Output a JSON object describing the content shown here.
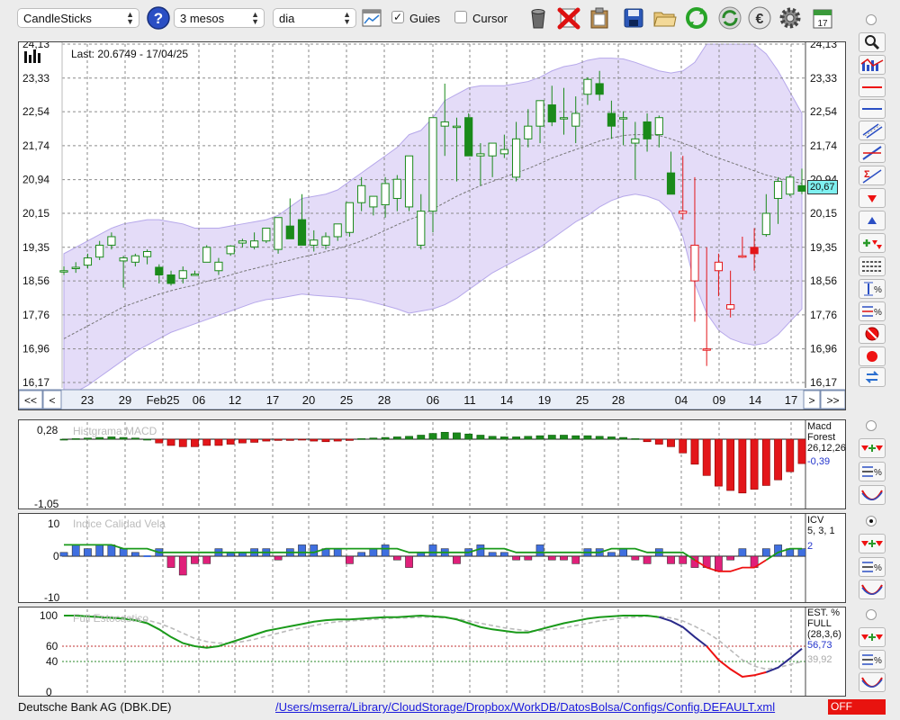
{
  "toolbar": {
    "chart_type": "CandleSticks",
    "period": "3 mesos",
    "interval": "dia",
    "guides_label": "Guies",
    "guides_checked": true,
    "cursor_label": "Cursor",
    "cursor_checked": false
  },
  "main": {
    "last_label": "Last: 20.6749 - 17/04/25",
    "current_price_label": "20,67",
    "y_ticks": [
      "24,13",
      "23,33",
      "22,54",
      "21,74",
      "20,94",
      "20,15",
      "19,35",
      "18,56",
      "17,76",
      "16,96",
      "16,17"
    ],
    "x_labels": [
      "23",
      "29",
      "Feb25",
      "06",
      "12",
      "17",
      "20",
      "25",
      "28",
      "06",
      "11",
      "14",
      "19",
      "25",
      "28",
      "04",
      "09",
      "14",
      "17"
    ],
    "nav_first": "<<",
    "nav_prev": "<",
    "nav_next": ">",
    "nav_last": ">>"
  },
  "macd": {
    "title": "Histgrama MACD",
    "name": "Macd",
    "sub": "Forest",
    "params": "26,12,26",
    "value": "-0,39",
    "y_top": "0,28",
    "y_bottom": "-1,05"
  },
  "icv": {
    "title": "Indice Calidad Vela",
    "name": "ICV",
    "params": "5, 3, 1",
    "value": "2",
    "y_top": "10",
    "y_mid": "0",
    "y_bottom": "-10"
  },
  "stoch": {
    "title": "Full Estocastico",
    "name": "EST. %",
    "sub": "FULL",
    "params": "(28,3,6)",
    "value1": "56,73",
    "value2": "39,92",
    "y_ticks": [
      "100",
      "60",
      "40",
      "0"
    ]
  },
  "status": {
    "symbol": "Deutsche Bank AG (DBK.DE)",
    "config_path": "/Users/mserra/Library/CloudStorage/Dropbox/WorkDB/DatosBolsa/Configs/Config.DEFAULT.xml",
    "mode": "OFF"
  },
  "colors": {
    "up": "#1a8a1a",
    "down": "#e3161a",
    "band": "#e4dcf8",
    "blue_bar": "#3f6fe0",
    "pink_bar": "#e0207a",
    "accent_label": "#7ff0f0"
  },
  "icons": [
    "help-icon",
    "chart-setup-icon",
    "trash-icon",
    "delete-icon",
    "clipboard-icon",
    "save-icon",
    "folder-icon",
    "refresh-icon",
    "sync-icon",
    "euro-icon",
    "gear-icon",
    "calendar-icon"
  ],
  "chart_data": {
    "type": "candlestick",
    "ylim": [
      16.17,
      24.13
    ],
    "dates": [
      "01-21",
      "01-22",
      "01-23",
      "01-24",
      "01-27",
      "01-28",
      "01-29",
      "01-30",
      "01-31",
      "02-03",
      "02-04",
      "02-05",
      "02-06",
      "02-07",
      "02-10",
      "02-11",
      "02-12",
      "02-13",
      "02-14",
      "02-17",
      "02-18",
      "02-19",
      "02-20",
      "02-21",
      "02-24",
      "02-25",
      "02-26",
      "02-27",
      "02-28",
      "03-03",
      "03-04",
      "03-05",
      "03-06",
      "03-07",
      "03-10",
      "03-11",
      "03-12",
      "03-13",
      "03-14",
      "03-17",
      "03-18",
      "03-19",
      "03-20",
      "03-21",
      "03-24",
      "03-25",
      "03-26",
      "03-27",
      "03-28",
      "03-31",
      "04-01",
      "04-02",
      "04-03",
      "04-04",
      "04-07",
      "04-08",
      "04-09",
      "04-10",
      "04-11",
      "04-14",
      "04-15",
      "04-16",
      "04-17"
    ],
    "open": [
      18.78,
      18.85,
      18.93,
      19.12,
      19.4,
      19.03,
      19.0,
      19.13,
      18.88,
      18.7,
      18.62,
      18.7,
      19.0,
      18.8,
      19.2,
      19.45,
      19.36,
      19.5,
      19.3,
      19.85,
      20.0,
      19.4,
      19.4,
      19.6,
      19.7,
      20.4,
      20.3,
      20.35,
      20.5,
      20.3,
      19.4,
      20.2,
      22.2,
      22.2,
      22.4,
      21.5,
      21.5,
      21.55,
      21.0,
      21.9,
      22.2,
      22.7,
      22.4,
      22.2,
      22.95,
      23.2,
      22.5,
      22.4,
      21.8,
      22.3,
      22.0,
      21.1,
      20.15,
      18.56,
      16.96,
      18.8,
      17.9,
      19.15,
      19.35,
      19.65,
      20.5,
      20.6,
      20.8
    ],
    "high": [
      18.9,
      19.0,
      19.2,
      19.5,
      19.7,
      19.15,
      19.2,
      19.3,
      18.95,
      18.8,
      18.9,
      18.8,
      19.4,
      19.1,
      19.4,
      19.55,
      19.7,
      19.8,
      20.05,
      20.5,
      20.6,
      19.75,
      19.7,
      19.9,
      20.4,
      21.0,
      20.55,
      21.0,
      21.05,
      21.5,
      20.6,
      22.2,
      23.2,
      22.4,
      22.5,
      21.8,
      21.6,
      22.0,
      22.3,
      22.6,
      22.7,
      23.15,
      23.1,
      22.9,
      23.35,
      23.5,
      22.8,
      22.55,
      22.3,
      22.5,
      22.45,
      21.6,
      21.5,
      21.0,
      19.35,
      19.2,
      18.8,
      19.6,
      19.8,
      20.6,
      21.0,
      21.05,
      21.2
    ],
    "low": [
      18.7,
      18.75,
      18.85,
      19.05,
      19.3,
      18.4,
      18.9,
      18.95,
      18.5,
      18.45,
      18.5,
      18.7,
      19.0,
      18.7,
      19.15,
      19.35,
      19.3,
      19.45,
      19.2,
      19.6,
      19.9,
      19.25,
      19.3,
      19.5,
      19.6,
      20.2,
      20.1,
      20.05,
      20.2,
      20.2,
      19.3,
      19.7,
      21.5,
      20.9,
      21.9,
      20.8,
      21.0,
      21.45,
      20.9,
      21.7,
      21.8,
      22.2,
      22.0,
      21.8,
      22.7,
      22.8,
      21.9,
      21.75,
      20.95,
      21.6,
      21.7,
      20.75,
      20.0,
      17.6,
      16.56,
      18.2,
      17.7,
      19.1,
      18.8,
      19.6,
      19.9,
      20.55,
      20.6
    ],
    "close": [
      18.8,
      18.88,
      19.1,
      19.4,
      19.6,
      19.1,
      19.15,
      19.25,
      18.7,
      18.5,
      18.8,
      18.72,
      19.35,
      19.0,
      19.38,
      19.5,
      19.5,
      19.8,
      20.05,
      19.55,
      19.4,
      19.52,
      19.6,
      19.9,
      20.4,
      20.8,
      20.55,
      20.85,
      20.95,
      21.5,
      20.2,
      22.4,
      22.3,
      22.2,
      21.5,
      21.55,
      21.8,
      21.65,
      21.9,
      22.2,
      22.8,
      22.3,
      22.4,
      22.5,
      23.3,
      22.95,
      22.2,
      22.4,
      21.9,
      21.9,
      22.4,
      20.6,
      20.2,
      19.4,
      16.96,
      19.0,
      18.0,
      19.15,
      19.2,
      20.15,
      20.9,
      21.0,
      20.67
    ],
    "bollinger_upper": [
      19.2,
      19.35,
      19.5,
      19.65,
      19.8,
      19.9,
      19.95,
      20.0,
      20.0,
      19.95,
      19.9,
      19.8,
      19.8,
      19.8,
      19.85,
      19.9,
      19.95,
      20.0,
      20.1,
      20.3,
      20.5,
      20.55,
      20.6,
      20.7,
      20.9,
      21.1,
      21.3,
      21.5,
      21.7,
      22.0,
      22.1,
      22.4,
      22.8,
      22.95,
      23.1,
      23.15,
      23.15,
      23.15,
      23.2,
      23.25,
      23.35,
      23.5,
      23.6,
      23.65,
      23.75,
      23.8,
      23.8,
      23.78,
      23.7,
      23.6,
      23.5,
      23.45,
      23.5,
      23.7,
      24.13,
      24.13,
      24.13,
      24.13,
      24.13,
      23.9,
      23.5,
      23.0,
      22.5
    ],
    "bollinger_middle": [
      17.2,
      17.35,
      17.5,
      17.65,
      17.8,
      17.95,
      18.05,
      18.15,
      18.25,
      18.33,
      18.4,
      18.46,
      18.55,
      18.62,
      18.7,
      18.78,
      18.85,
      18.92,
      18.98,
      19.05,
      19.12,
      19.18,
      19.25,
      19.32,
      19.4,
      19.5,
      19.62,
      19.75,
      19.88,
      20.0,
      20.1,
      20.25,
      20.4,
      20.55,
      20.68,
      20.8,
      20.9,
      21.0,
      21.1,
      21.2,
      21.32,
      21.45,
      21.55,
      21.65,
      21.75,
      21.85,
      21.92,
      21.98,
      22.0,
      22.0,
      21.98,
      21.9,
      21.8,
      21.7,
      21.55,
      21.45,
      21.35,
      21.25,
      21.15,
      21.05,
      20.98,
      20.92,
      20.85
    ],
    "bollinger_lower": [
      15.8,
      15.95,
      16.1,
      16.3,
      16.5,
      16.7,
      16.9,
      17.05,
      17.2,
      17.35,
      17.45,
      17.55,
      17.65,
      17.75,
      17.85,
      17.95,
      18.05,
      18.12,
      18.15,
      18.2,
      18.25,
      18.22,
      18.2,
      18.18,
      18.15,
      18.12,
      18.05,
      17.98,
      17.9,
      17.8,
      17.85,
      17.9,
      18.0,
      18.15,
      18.35,
      18.55,
      18.75,
      18.9,
      19.05,
      19.2,
      19.35,
      19.55,
      19.75,
      19.95,
      20.1,
      20.3,
      20.45,
      20.55,
      20.6,
      20.55,
      20.45,
      20.2,
      19.6,
      18.5,
      17.8,
      17.4,
      17.2,
      17.1,
      17.05,
      17.1,
      17.3,
      17.6,
      17.9
    ],
    "macd_hist": [
      0.0,
      0.02,
      0.04,
      0.06,
      0.08,
      0.06,
      0.04,
      0.0,
      -0.06,
      -0.1,
      -0.12,
      -0.12,
      -0.1,
      -0.1,
      -0.08,
      -0.06,
      -0.05,
      -0.03,
      -0.02,
      -0.02,
      -0.01,
      -0.03,
      -0.04,
      -0.03,
      -0.02,
      0.02,
      0.04,
      0.06,
      0.08,
      0.1,
      0.14,
      0.2,
      0.24,
      0.22,
      0.18,
      0.14,
      0.1,
      0.08,
      0.08,
      0.1,
      0.12,
      0.14,
      0.14,
      0.12,
      0.12,
      0.1,
      0.08,
      0.06,
      0.02,
      -0.04,
      -0.08,
      -0.12,
      -0.22,
      -0.4,
      -0.58,
      -0.75,
      -0.82,
      -0.86,
      -0.8,
      -0.74,
      -0.65,
      -0.52,
      -0.39
    ],
    "icv_bars": [
      1,
      3,
      2,
      3,
      3,
      2,
      1,
      0,
      2,
      -3,
      -5,
      -2,
      -2,
      2,
      1,
      1,
      2,
      2,
      -1,
      2,
      3,
      3,
      2,
      2,
      -2,
      1,
      2,
      3,
      -1,
      -3,
      1,
      3,
      2,
      -2,
      2,
      3,
      1,
      1,
      -1,
      -1,
      3,
      -1,
      -1,
      -2,
      2,
      2,
      1,
      2,
      -1,
      -2,
      2,
      -2,
      -2,
      -3,
      -3,
      -4,
      -1,
      2,
      -3,
      2,
      3,
      2,
      2
    ],
    "icv_line": [
      3,
      3,
      3,
      3,
      3,
      2,
      2,
      2,
      1,
      1,
      1,
      1,
      1,
      1,
      1,
      1,
      1,
      1,
      1,
      1,
      1,
      1,
      2,
      2,
      2,
      2,
      2,
      2,
      2,
      1,
      1,
      1,
      1,
      1,
      1,
      2,
      2,
      2,
      1,
      1,
      1,
      1,
      1,
      1,
      1,
      1,
      2,
      2,
      2,
      1,
      1,
      1,
      1,
      -1,
      -3,
      -4,
      -4,
      -3,
      -3,
      -1,
      1,
      2,
      2
    ],
    "stoch_k": [
      100,
      100,
      99,
      98,
      97,
      96,
      94,
      90,
      82,
      72,
      64,
      60,
      58,
      60,
      65,
      70,
      75,
      80,
      83,
      86,
      89,
      92,
      94,
      95,
      95,
      96,
      97,
      98,
      98,
      99,
      100,
      99,
      98,
      95,
      90,
      85,
      82,
      80,
      78,
      78,
      82,
      86,
      90,
      93,
      96,
      98,
      99,
      100,
      100,
      100,
      98,
      93,
      85,
      72,
      60,
      42,
      30,
      20,
      22,
      26,
      32,
      44,
      56.73
    ],
    "stoch_d": [
      100,
      100,
      100,
      99,
      98,
      97,
      96,
      94,
      90,
      84,
      77,
      70,
      66,
      64,
      64,
      66,
      69,
      73,
      77,
      81,
      84,
      87,
      90,
      92,
      93,
      94,
      95,
      96,
      97,
      97,
      98,
      98,
      97,
      96,
      93,
      90,
      87,
      84,
      82,
      80,
      80,
      82,
      84,
      87,
      90,
      93,
      95,
      97,
      98,
      99,
      99,
      97,
      93,
      86,
      78,
      68,
      55,
      42,
      34,
      30,
      32,
      36,
      39.92
    ]
  }
}
